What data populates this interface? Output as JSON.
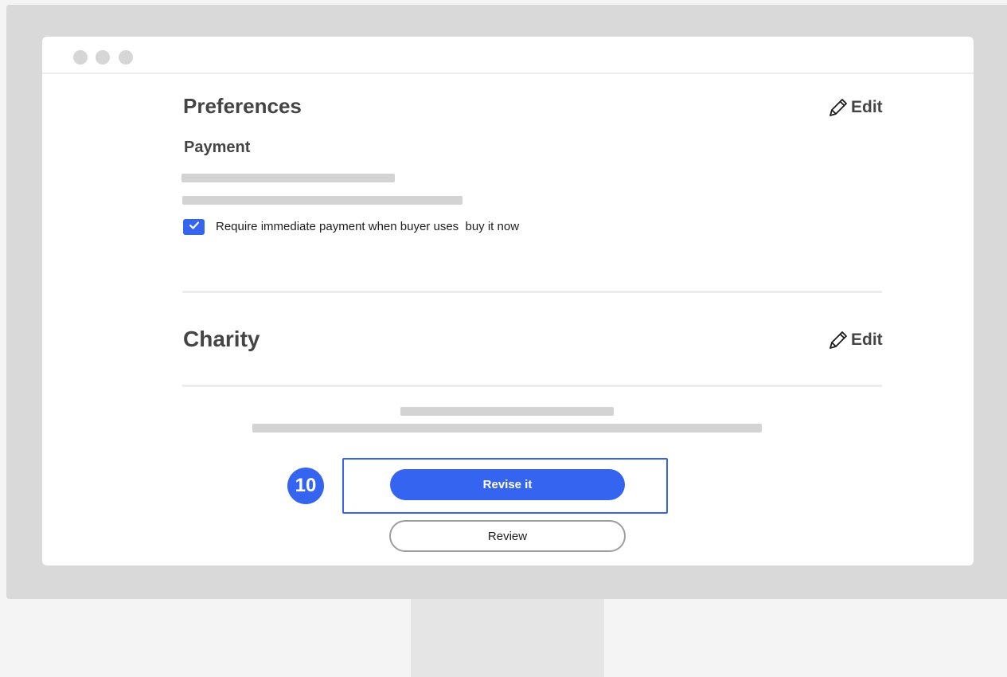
{
  "window": {
    "controls": [
      "dot",
      "dot",
      "dot"
    ]
  },
  "preferences": {
    "title": "Preferences",
    "edit_label": "Edit",
    "payment": {
      "title": "Payment",
      "checkbox_label": "Require immediate payment when buyer uses  buy it now",
      "checkbox_checked": true
    }
  },
  "charity": {
    "title": "Charity",
    "edit_label": "Edit"
  },
  "actions": {
    "step_number": "10",
    "primary_label": "Revise it",
    "secondary_label": "Review"
  },
  "colors": {
    "accent": "#3565f0",
    "text": "#444444",
    "placeholder": "#d3d3d3"
  }
}
